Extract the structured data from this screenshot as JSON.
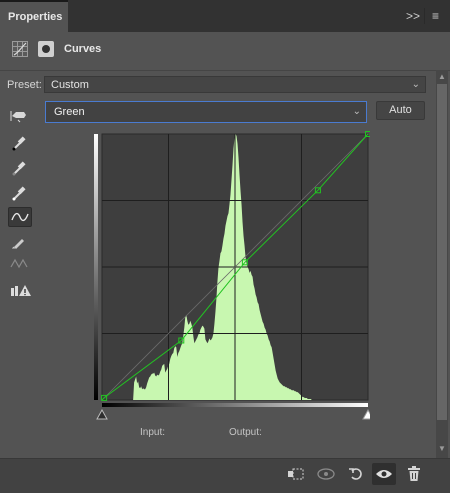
{
  "panel": {
    "tab_title": "Properties",
    "menu_expand_label": ">>",
    "menu_icon": "hamburger-icon"
  },
  "header": {
    "title": "Curves",
    "icons": [
      "curves-adjustment-icon",
      "layer-mask-icon"
    ]
  },
  "preset": {
    "label": "Preset:",
    "value": "Custom"
  },
  "channel": {
    "value": "Green",
    "auto_label": "Auto"
  },
  "toolbar": {
    "items": [
      {
        "name": "on-image-adjust-icon",
        "glyph": "☚"
      },
      {
        "name": "black-point-eyedropper-icon",
        "glyph": "✎"
      },
      {
        "name": "gray-point-eyedropper-icon",
        "glyph": "✎"
      },
      {
        "name": "white-point-eyedropper-icon",
        "glyph": "✎"
      },
      {
        "name": "edit-points-curve-icon",
        "glyph": "∿"
      },
      {
        "name": "draw-pencil-icon",
        "glyph": "✏"
      },
      {
        "name": "smooth-curve-icon",
        "glyph": "⤨"
      },
      {
        "name": "clipping-warning-icon",
        "glyph": "▟⚠"
      }
    ]
  },
  "graph": {
    "input_label": "Input:",
    "output_label": "Output:",
    "curve_color": "#22c322",
    "histogram_color": "#c8f7b0",
    "curve_points": [
      [
        2,
        2
      ],
      [
        76,
        57
      ],
      [
        137,
        132
      ],
      [
        207,
        201
      ],
      [
        255,
        255
      ]
    ],
    "histogram": [
      0,
      0,
      0,
      0,
      0,
      0,
      0,
      0,
      0,
      0,
      0,
      0,
      0,
      0,
      0,
      0,
      0,
      0,
      0,
      0,
      0,
      0,
      0,
      0,
      0,
      0,
      0,
      0,
      0,
      0,
      0,
      0,
      18,
      21,
      24,
      17,
      19,
      13,
      12,
      14,
      11,
      12,
      11,
      11,
      13,
      17,
      20,
      23,
      24,
      26,
      27,
      27,
      28,
      25,
      24,
      26,
      25,
      26,
      29,
      31,
      35,
      36,
      37,
      28,
      30,
      32,
      35,
      37,
      42,
      45,
      47,
      48,
      53,
      55,
      54,
      44,
      48,
      50,
      53,
      56,
      58,
      66,
      74,
      85,
      87,
      81,
      77,
      78,
      81,
      78,
      74,
      65,
      58,
      60,
      62,
      64,
      67,
      68,
      72,
      74,
      76,
      75,
      73,
      62,
      60,
      58,
      60,
      63,
      61,
      62,
      64,
      68,
      78,
      90,
      104,
      121,
      135,
      142,
      150,
      152,
      158,
      165,
      170,
      178,
      183,
      188,
      191,
      200,
      210,
      225,
      240,
      257,
      268,
      272,
      270,
      262,
      248,
      230,
      214,
      200,
      182,
      168,
      158,
      146,
      140,
      136,
      134,
      130,
      132,
      128,
      126,
      118,
      114,
      108,
      105,
      100,
      98,
      92,
      88,
      84,
      80,
      78,
      74,
      72,
      68,
      66,
      62,
      60,
      56,
      54,
      48,
      42,
      36,
      30,
      26,
      22,
      20,
      18,
      17,
      16,
      15,
      14,
      14,
      13,
      13,
      12,
      12,
      11,
      11,
      10,
      10,
      10,
      9,
      9,
      8,
      8,
      7,
      6,
      5,
      4,
      3,
      3,
      2,
      2,
      2,
      1,
      1,
      1,
      1,
      0,
      0,
      0,
      0,
      0,
      0,
      0,
      0,
      0,
      0,
      0,
      0,
      0,
      0,
      0,
      0,
      0,
      0,
      0,
      0,
      0,
      0,
      0,
      0,
      0,
      0,
      0,
      0,
      0,
      0,
      0,
      0,
      0,
      0,
      0,
      0,
      0,
      0,
      0,
      0,
      0,
      0,
      0,
      0,
      0,
      0,
      0,
      0,
      0,
      0,
      0,
      0,
      0,
      0,
      0,
      0,
      0
    ]
  },
  "bottom_bar": {
    "buttons": [
      {
        "name": "clip-to-layer-icon",
        "glyph": "⬚"
      },
      {
        "name": "view-previous-state-icon",
        "glyph": "◉"
      },
      {
        "name": "reset-adjustment-icon",
        "glyph": "↺"
      },
      {
        "name": "toggle-visibility-icon",
        "glyph": "👁"
      },
      {
        "name": "delete-adjustment-icon",
        "glyph": "🗑"
      }
    ]
  }
}
